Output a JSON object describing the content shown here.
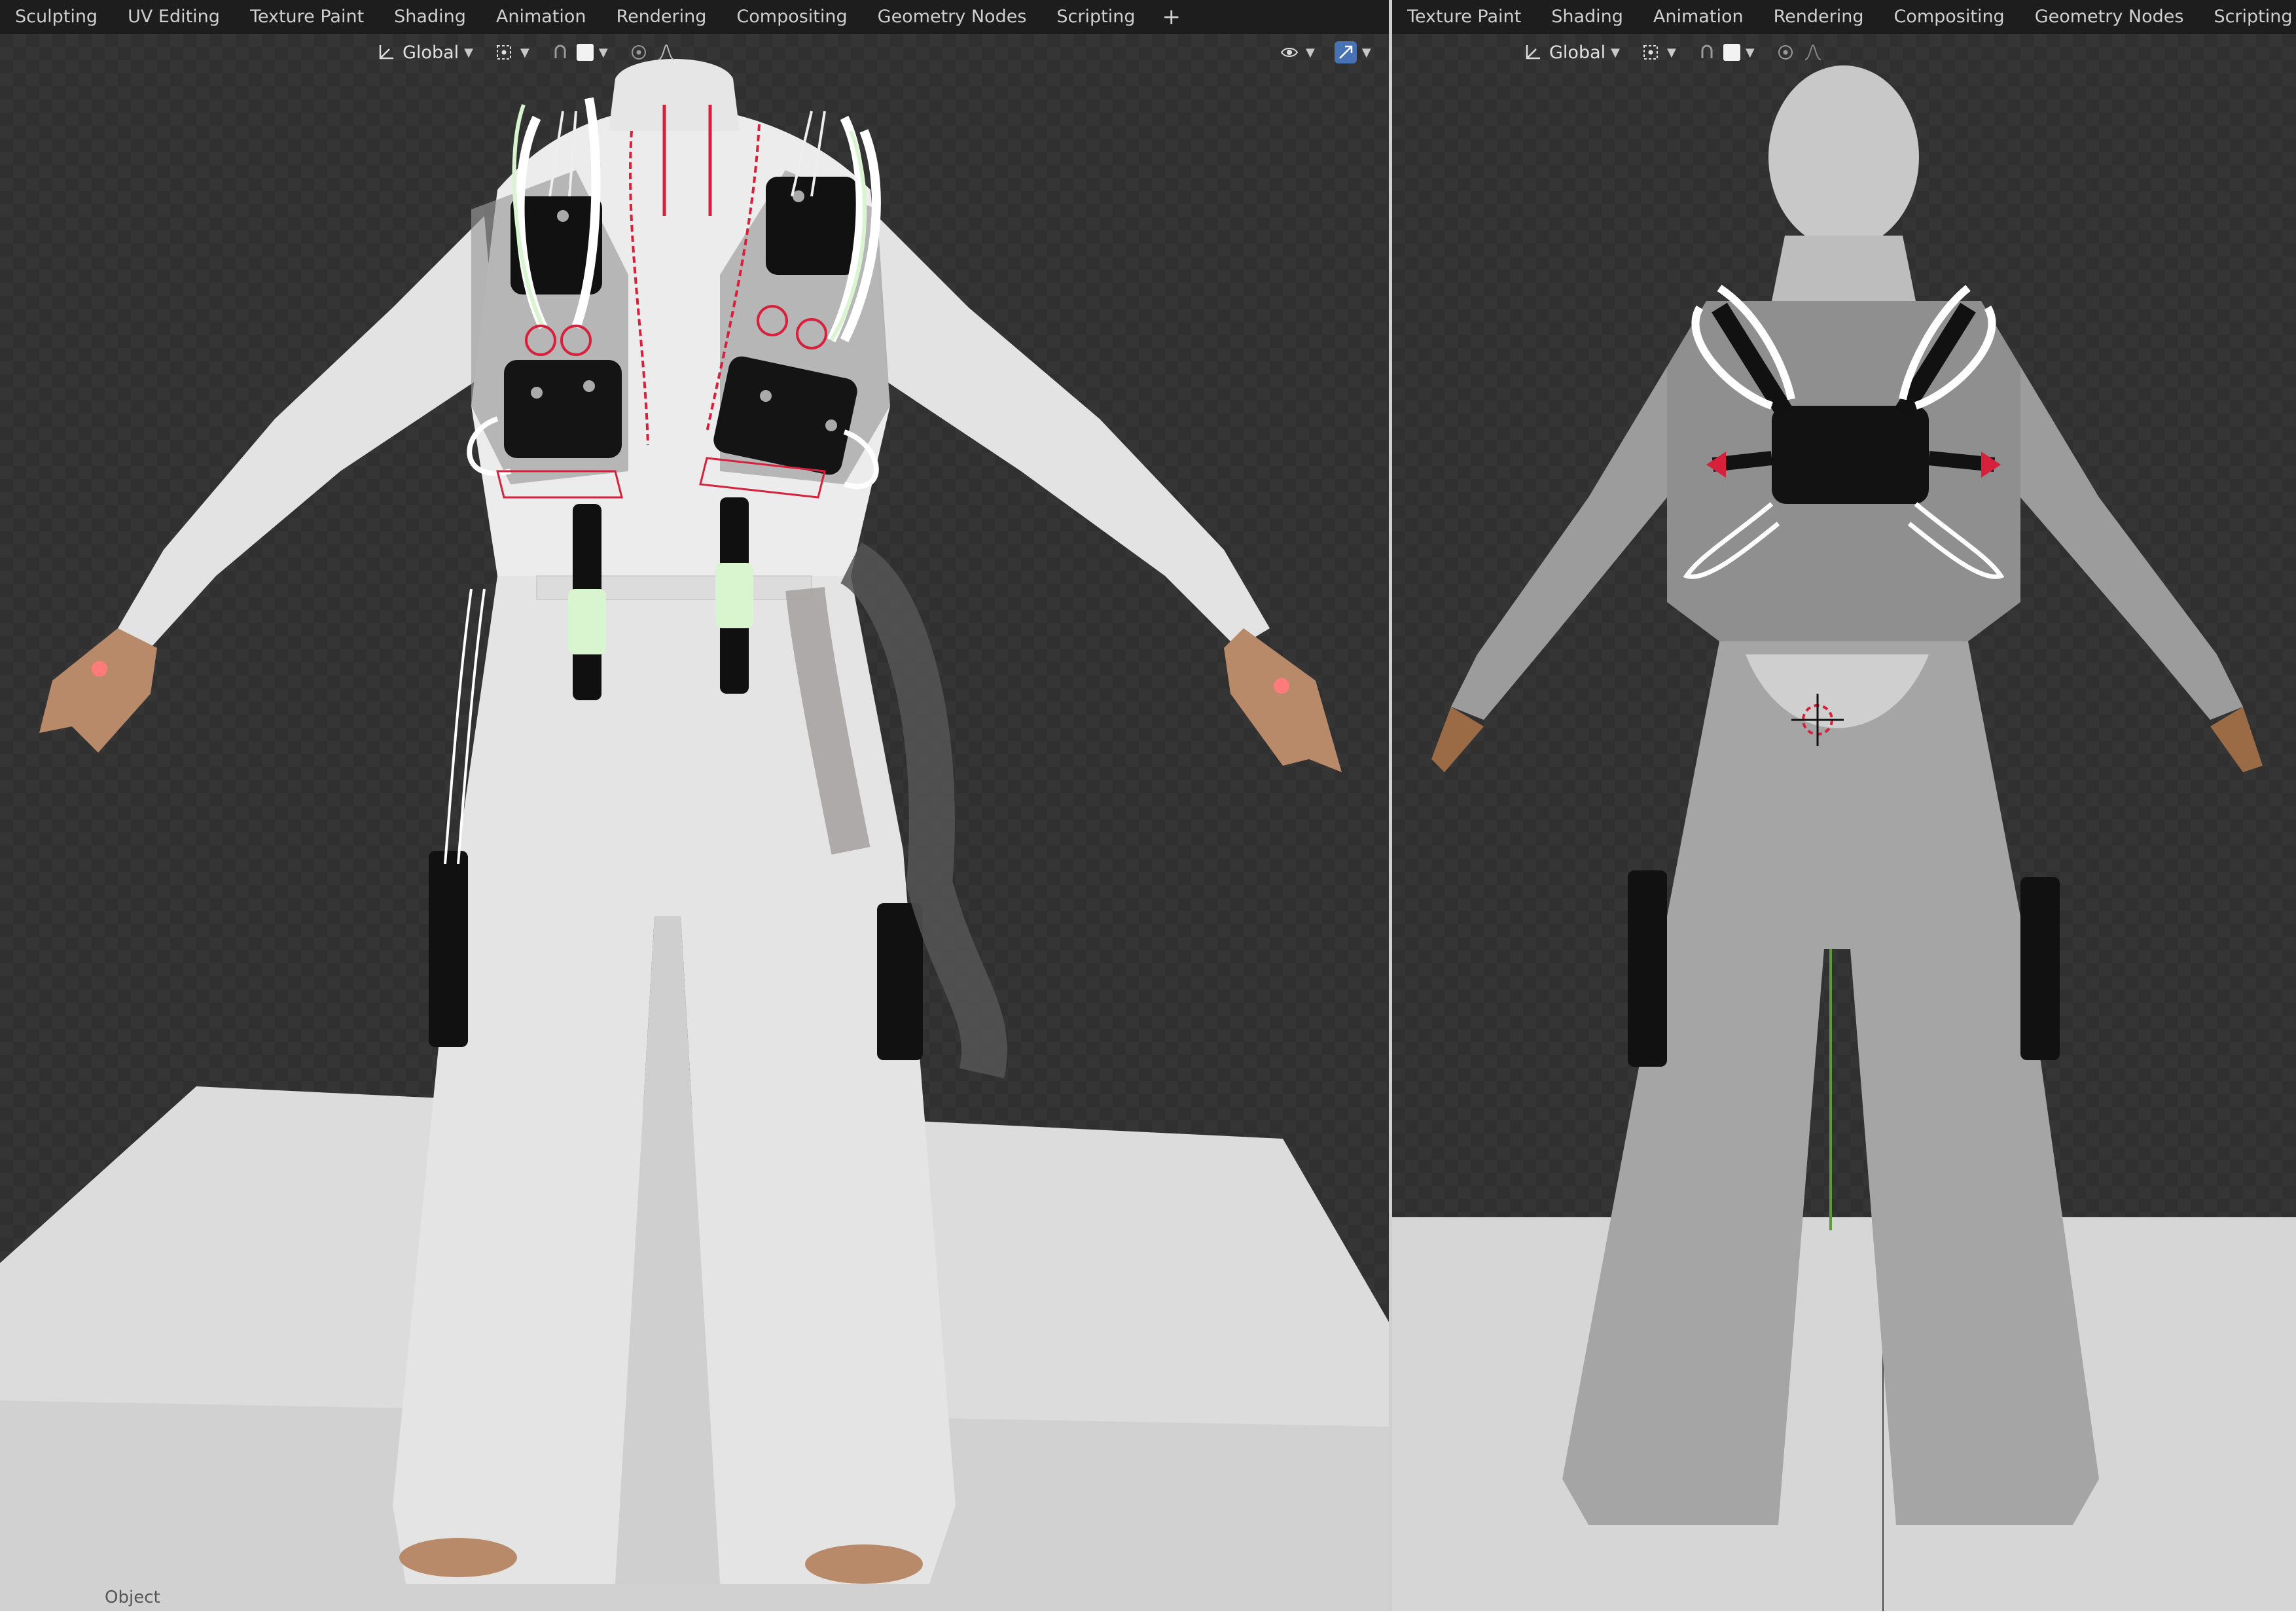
{
  "left_viewport": {
    "workspace_tabs": [
      "Sculpting",
      "UV Editing",
      "Texture Paint",
      "Shading",
      "Animation",
      "Rendering",
      "Compositing",
      "Geometry Nodes",
      "Scripting"
    ],
    "add_workspace": "+",
    "orientation_label": "Global",
    "mode_label": "Object"
  },
  "right_viewport": {
    "workspace_tabs": [
      "Texture Paint",
      "Shading",
      "Animation",
      "Rendering",
      "Compositing",
      "Geometry Nodes",
      "Scripting"
    ],
    "add_workspace": "+",
    "orientation_label": "Global"
  },
  "colors": {
    "header_bg": "#1d1d1d",
    "viewport_bg": "#2f2f2f",
    "accent_blue": "#4772b3",
    "suit_white": "#e8e8e8",
    "harness_black": "#111111",
    "annotation_red": "#d6203c",
    "annotation_green": "#d8f5d0"
  },
  "icons": [
    "transform-orientation-icon",
    "pivot-point-icon",
    "snap-icon",
    "proportional-editing-icon",
    "falloff-icon",
    "visibility-icon",
    "gizmo-icon",
    "3d-cursor-icon"
  ]
}
